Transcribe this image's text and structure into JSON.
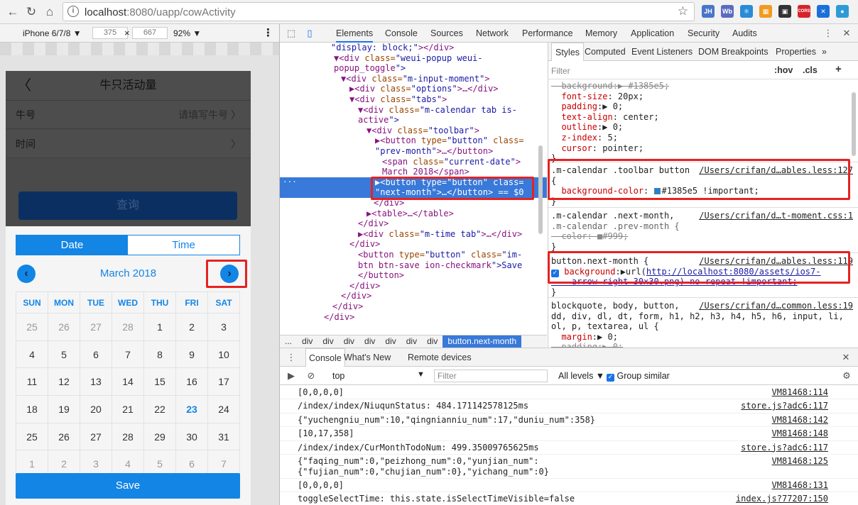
{
  "browser": {
    "url_host": "localhost",
    "url_rest": ":8080/uapp/cowActivity",
    "extensions": [
      {
        "name": "jh-extension",
        "label": "JH",
        "color": "#4a76c9"
      },
      {
        "name": "wb-extension",
        "label": "Wb",
        "color": "#5b6bc0"
      },
      {
        "name": "react-extension",
        "label": "⚛",
        "color": "#2a8bd6"
      },
      {
        "name": "ext-orange",
        "label": "▦",
        "color": "#f39a1e"
      },
      {
        "name": "qr-extension",
        "label": "▣",
        "color": "#333333"
      },
      {
        "name": "cors-extension",
        "label": "CORS",
        "color": "#d8232a"
      },
      {
        "name": "ext-blue",
        "label": "✕",
        "color": "#1c6fd9"
      },
      {
        "name": "ext-globe",
        "label": "●",
        "color": "#2e9bd6"
      }
    ]
  },
  "device_toolbar": {
    "device": "iPhone 6/7/8 ▼",
    "width": "375",
    "times": "×",
    "height": "667",
    "zoom": "92% ▼"
  },
  "phone": {
    "title": "牛只活动量",
    "rows": [
      {
        "label": "牛号",
        "value": "请填写牛号 〉"
      },
      {
        "label": "时间",
        "value": "〉"
      }
    ],
    "query_label": "查询",
    "tabs": [
      "Date",
      "Time"
    ],
    "month": "March 2018",
    "prev_arrow": "‹",
    "next_arrow": "›",
    "weekdays": [
      "SUN",
      "MON",
      "TUE",
      "WED",
      "THU",
      "FRI",
      "SAT"
    ],
    "weeks": [
      [
        "25",
        "26",
        "27",
        "28",
        "1",
        "2",
        "3"
      ],
      [
        "4",
        "5",
        "6",
        "7",
        "8",
        "9",
        "10"
      ],
      [
        "11",
        "12",
        "13",
        "14",
        "15",
        "16",
        "17"
      ],
      [
        "18",
        "19",
        "20",
        "21",
        "22",
        "23",
        "24"
      ],
      [
        "25",
        "26",
        "27",
        "28",
        "29",
        "30",
        "31"
      ],
      [
        "1",
        "2",
        "3",
        "4",
        "5",
        "6",
        "7"
      ]
    ],
    "save_label": "Save"
  },
  "devtools": {
    "tabs": [
      "Elements",
      "Console",
      "Sources",
      "Network",
      "Performance",
      "Memory",
      "Application",
      "Security",
      "Audits"
    ],
    "elements_lines": [
      "\"display: block;\"></div>",
      "▼<div class=\"weui-popup weui-",
      "popup_toggle\">",
      "▼<div class=\"m-input-moment\">",
      "▶<div class=\"options\">…</div>",
      "▼<div class=\"tabs\">",
      "▼<div class=\"m-calendar tab is-",
      "active\">",
      "▼<div class=\"toolbar\">",
      "▶<button type=\"button\" class=",
      "\"prev-month\">…</button>",
      "<span class=\"current-date\">",
      "March 2018</span>",
      "▶<button type=\"button\" class=",
      "\"next-month\">…</button> == $0",
      "</div>",
      "▶<table>…</table>",
      "</div>",
      "▶<div class=\"m-time tab\">…</div>",
      "</div>",
      "<button type=\"button\" class=\"im-",
      "btn btn-save ion-checkmark\">Save",
      "</button>",
      "</div>",
      "</div>",
      "</div>",
      "</div>"
    ],
    "crumbs": [
      "...",
      "div",
      "div",
      "div",
      "div",
      "div",
      "div",
      "div",
      "button.next-month"
    ],
    "styles_tabs": [
      "Styles",
      "Computed",
      "Event Listeners",
      "DOM Breakpoints",
      "Properties",
      "»"
    ],
    "filter_placeholder": "Filter",
    "hov": ":hov",
    "cls": ".cls",
    "styles_lines": [
      {
        "t": "  background:▶ #1385e5;",
        "k": "strike"
      },
      {
        "t": "  font-size: 20px;",
        "k": "prop"
      },
      {
        "t": "  padding:▶ 0;",
        "k": "prop"
      },
      {
        "t": "  text-align: center;",
        "k": "prop"
      },
      {
        "t": "  outline:▶ 0;",
        "k": "prop"
      },
      {
        "t": "  z-index: 5;",
        "k": "prop"
      },
      {
        "t": "  cursor: pointer;",
        "k": "prop"
      },
      {
        "t": "}",
        "k": "plain"
      },
      {
        "t": ".m-calendar .toolbar button",
        "k": "sel",
        "src": "/Users/crifan/d…ables.less:127"
      },
      {
        "t": "{",
        "k": "plain"
      },
      {
        "t": "  background-color: ■#1385e5 !important;",
        "k": "prop"
      },
      {
        "t": "}",
        "k": "plain"
      },
      {
        "t": ".m-calendar .next-month,",
        "k": "sel",
        "src": "/Users/crifan/d…t-moment.css:1"
      },
      {
        "t": ".m-calendar .prev-month {",
        "k": "dim"
      },
      {
        "t": "  color: ■#999;",
        "k": "strike"
      },
      {
        "t": "}",
        "k": "plain"
      },
      {
        "t": "button.next-month {",
        "k": "sel",
        "src": "/Users/crifan/d…ables.less:119"
      },
      {
        "t": "background:▶url(http://localhost:8080/assets/ios7-",
        "k": "check"
      },
      {
        "t": "    arrow-right-30x30.png) no-repeat !important;",
        "k": "link"
      },
      {
        "t": "}",
        "k": "plain"
      },
      {
        "t": "blockquote, body, button,",
        "k": "sel",
        "src": "/Users/crifan/d…common.less:19"
      },
      {
        "t": "dd, div, dl, dt, form, h1, h2, h3, h4, h5, h6, input, li,",
        "k": "plain"
      },
      {
        "t": "ol, p, textarea, ul {",
        "k": "plain"
      },
      {
        "t": "  margin:▶ 0;",
        "k": "prop"
      },
      {
        "t": "  padding:▶ 0;",
        "k": "strike"
      }
    ],
    "console_tabs": [
      "Console",
      "What's New",
      "Remote devices"
    ],
    "console_context": "top",
    "console_filter": "Filter",
    "console_levels": "All levels ▼",
    "console_group": "Group similar",
    "console_lines": [
      {
        "msg": "[0,0,0,0]",
        "src": "VM81468:114"
      },
      {
        "msg": "/index/index/NiuqunStatus: 484.171142578125ms",
        "src": "store.js?adc6:117"
      },
      {
        "msg": "{\"yuchengniu_num\":10,\"qingnianniu_num\":17,\"duniu_num\":358}",
        "src": "VM81468:142"
      },
      {
        "msg": "[10,17,358]",
        "src": "VM81468:148"
      },
      {
        "msg": "/index/index/CurMonthTodoNum: 499.35009765625ms",
        "src": "store.js?adc6:117"
      },
      {
        "msg": "{\"faqing_num\":0,\"peizhong_num\":0,\"yunjian_num\":\n{\"fujian_num\":0,\"chujian_num\":0},\"yichang_num\":0}",
        "src": "VM81468:125"
      },
      {
        "msg": "[0,0,0,0]",
        "src": "VM81468:131"
      },
      {
        "msg": "toggleSelectTime: this.state.isSelectTimeVisible=false",
        "src": "index.js?77207:150"
      }
    ]
  }
}
